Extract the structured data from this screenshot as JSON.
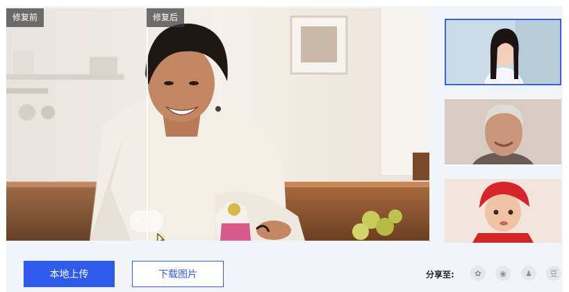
{
  "viewer": {
    "before_label": "修复前",
    "after_label": "修复后",
    "slider_left": "‹",
    "slider_right": "›"
  },
  "thumbnails": [
    {
      "name": "young-woman-portrait",
      "selected": true
    },
    {
      "name": "elderly-man-portrait",
      "selected": false
    },
    {
      "name": "child-red-hat-portrait",
      "selected": false
    }
  ],
  "actions": {
    "upload_label": "本地上传",
    "download_label": "下载图片"
  },
  "share": {
    "label": "分享至:",
    "icons": [
      {
        "name": "qq-zone-icon",
        "glyph": "✿"
      },
      {
        "name": "weibo-icon",
        "glyph": "◉"
      },
      {
        "name": "qq-icon",
        "glyph": "♟"
      },
      {
        "name": "douban-icon",
        "glyph": "豆"
      }
    ]
  },
  "colors": {
    "accent": "#2f5bea",
    "background": "#f1f4f8"
  }
}
